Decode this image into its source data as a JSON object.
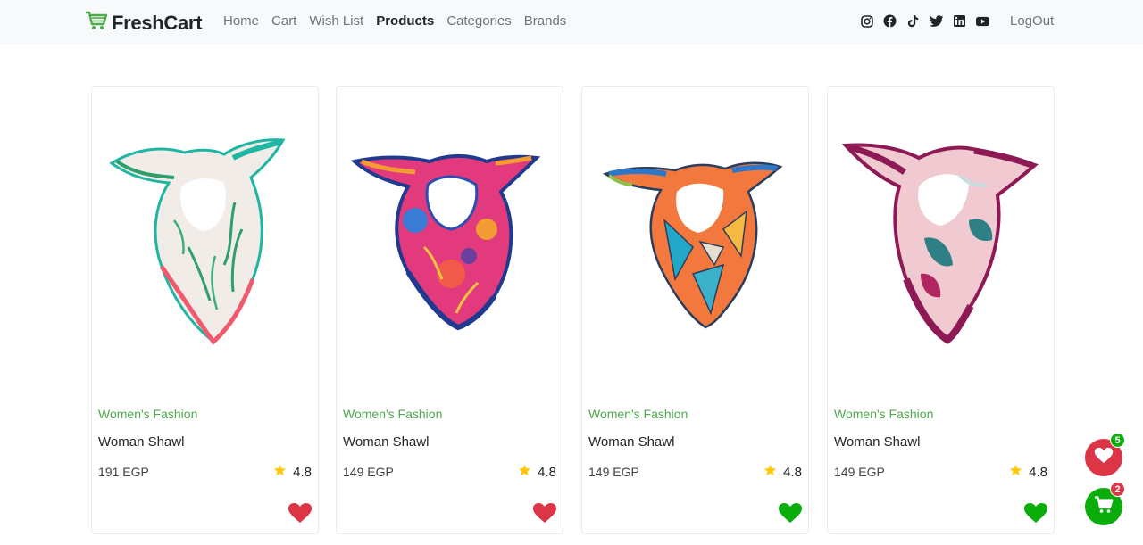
{
  "brand": {
    "name": "FreshCart",
    "icon": "cart-icon",
    "color": "#4fa94d"
  },
  "nav": {
    "links": [
      "Home",
      "Cart",
      "Wish List",
      "Products",
      "Categories",
      "Brands"
    ],
    "active": "Products",
    "socials": [
      "instagram-icon",
      "facebook-icon",
      "tiktok-icon",
      "twitter-icon",
      "linkedin-icon",
      "youtube-icon"
    ],
    "logout": "LogOut"
  },
  "products": [
    {
      "category": "Women's Fashion",
      "title": "Woman Shawl",
      "price": "191 EGP",
      "rating": "4.8",
      "wishlisted": true
    },
    {
      "category": "Women's Fashion",
      "title": "Woman Shawl",
      "price": "149 EGP",
      "rating": "4.8",
      "wishlisted": true
    },
    {
      "category": "Women's Fashion",
      "title": "Woman Shawl",
      "price": "149 EGP",
      "rating": "4.8",
      "wishlisted": false
    },
    {
      "category": "Women's Fashion",
      "title": "Woman Shawl",
      "price": "149 EGP",
      "rating": "4.8",
      "wishlisted": false
    }
  ],
  "floating": {
    "wishlist_count": "5",
    "cart_count": "2"
  },
  "colors": {
    "accent_green": "#4fa94d",
    "heart_red": "#dc3545",
    "heart_green": "#0aad0a",
    "star": "#ffc908"
  }
}
